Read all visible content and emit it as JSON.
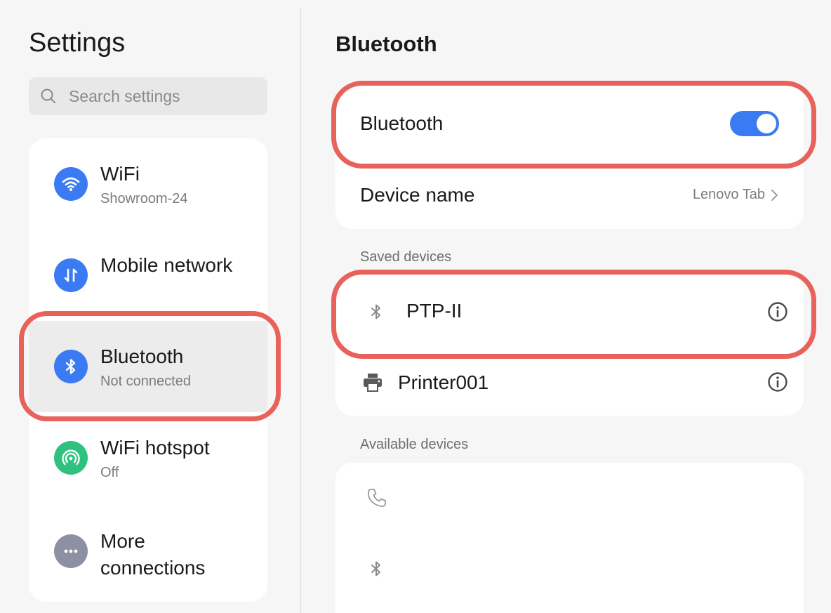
{
  "sidebar": {
    "title": "Settings",
    "search_placeholder": "Search settings",
    "items": [
      {
        "label": "WiFi",
        "sublabel": "Showroom-24",
        "icon": "wifi-icon",
        "color": "#3a7af2"
      },
      {
        "label": "Mobile network",
        "sublabel": "",
        "icon": "mobile-data-icon",
        "color": "#3a7af2"
      },
      {
        "label": "Bluetooth",
        "sublabel": "Not connected",
        "icon": "bluetooth-icon",
        "color": "#3a7af2",
        "active": true
      },
      {
        "label": "WiFi hotspot",
        "sublabel": "Off",
        "icon": "hotspot-icon",
        "color": "#2ec27e"
      },
      {
        "label": "More connections",
        "sublabel": "",
        "icon": "more-icon",
        "color": "#8e8fa3"
      }
    ]
  },
  "main": {
    "title": "Bluetooth",
    "bluetooth_toggle_label": "Bluetooth",
    "bluetooth_enabled": true,
    "device_name_label": "Device name",
    "device_name_value": "Lenovo Tab",
    "saved_devices_label": "Saved devices",
    "saved_devices": [
      {
        "name": "PTP-II",
        "icon": "bluetooth-icon"
      },
      {
        "name": "Printer001",
        "icon": "printer-icon"
      }
    ],
    "available_devices_label": "Available devices",
    "available_devices": [
      {
        "icon": "phone-icon"
      },
      {
        "icon": "bluetooth-icon"
      }
    ]
  },
  "colors": {
    "accent": "#3a7af2",
    "highlight": "#e8625b",
    "background": "#f6f6f6"
  }
}
